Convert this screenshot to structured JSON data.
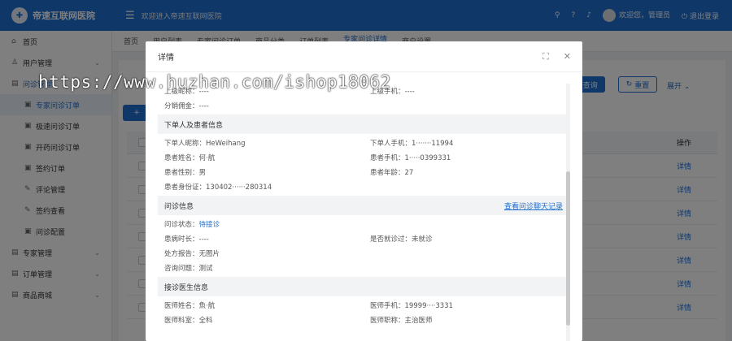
{
  "header": {
    "logo_text": "帝速互联网医院",
    "welcome": "欢迎进入帝速互联网医院",
    "user": "欢迎您，管理员",
    "logout": "退出登录",
    "icons": [
      "search-icon",
      "help-icon",
      "bell-icon"
    ]
  },
  "sidebar": {
    "items": [
      {
        "label": "首页",
        "icon": "⌂",
        "level": "top"
      },
      {
        "label": "用户管理",
        "icon": "♙",
        "level": "top",
        "chevron": true
      },
      {
        "label": "问诊管理",
        "icon": "▤",
        "level": "top",
        "chevron": true,
        "active_parent": true
      },
      {
        "label": "专家问诊订单",
        "icon": "▣",
        "level": "sub",
        "active": true
      },
      {
        "label": "极速问诊订单",
        "icon": "▣",
        "level": "sub"
      },
      {
        "label": "开药问诊订单",
        "icon": "▣",
        "level": "sub"
      },
      {
        "label": "签约订单",
        "icon": "▣",
        "level": "sub"
      },
      {
        "label": "评论管理",
        "icon": "✎",
        "level": "sub"
      },
      {
        "label": "签约查看",
        "icon": "✎",
        "level": "sub"
      },
      {
        "label": "问诊配置",
        "icon": "▣",
        "level": "sub"
      },
      {
        "label": "专家管理",
        "icon": "▤",
        "level": "top",
        "chevron": true
      },
      {
        "label": "订单管理",
        "icon": "▤",
        "level": "top",
        "chevron": true
      },
      {
        "label": "商品商城",
        "icon": "▤",
        "level": "top",
        "chevron": true
      }
    ]
  },
  "tabs": [
    "首页",
    "用户列表",
    "专家问诊订单",
    "商品分类",
    "订单列表",
    "专家问诊详情",
    "商户设置"
  ],
  "toolbar": {
    "search": "查询",
    "reset": "重置",
    "expand": "展开",
    "add": "+"
  },
  "table": {
    "col_op": "操作",
    "rows": [
      "详情",
      "详情",
      "详情",
      "详情",
      "详情",
      "详情",
      "详情"
    ]
  },
  "modal": {
    "title": "详情",
    "top_rows": [
      [
        {
          "label": "上级昵称：",
          "value": "----"
        },
        {
          "label": "上级手机：",
          "value": "----"
        }
      ],
      [
        {
          "label": "分销佣金：",
          "value": "----"
        }
      ]
    ],
    "section_buyer": "下单人及患者信息",
    "buyer_rows": [
      [
        {
          "label": "下单人昵称：",
          "value": "HeWeihang"
        },
        {
          "label": "下单人手机：",
          "value": "1·······11994"
        }
      ],
      [
        {
          "label": "患者姓名：",
          "value": "何·航"
        },
        {
          "label": "患者手机：",
          "value": "1·····0399331"
        }
      ],
      [
        {
          "label": "患者性别：",
          "value": "男"
        },
        {
          "label": "患者年龄：",
          "value": "27"
        }
      ],
      [
        {
          "label": "患者身份证：",
          "value": "130402······280314"
        }
      ]
    ],
    "section_consult": "问诊信息",
    "consult_link": "查看问诊聊天记录",
    "consult_rows": [
      [
        {
          "label": "问诊状态：",
          "value": "待接诊",
          "blue": true
        }
      ],
      [
        {
          "label": "患病时长：",
          "value": "----"
        },
        {
          "label": "是否就诊过：",
          "value": "未就诊"
        }
      ],
      [
        {
          "label": "处方报告：",
          "value": "无图片"
        }
      ],
      [
        {
          "label": "咨询问题：",
          "value": "测试"
        }
      ]
    ],
    "section_doctor": "接诊医生信息",
    "doctor_rows": [
      [
        {
          "label": "医师姓名：",
          "value": "魚·航"
        },
        {
          "label": "医师手机：",
          "value": "19999····3331"
        }
      ],
      [
        {
          "label": "医师科室：",
          "value": "全科"
        },
        {
          "label": "医师职称：",
          "value": "主治医师"
        }
      ]
    ]
  },
  "watermark": "https://www.huzhan.com/ishop18062"
}
